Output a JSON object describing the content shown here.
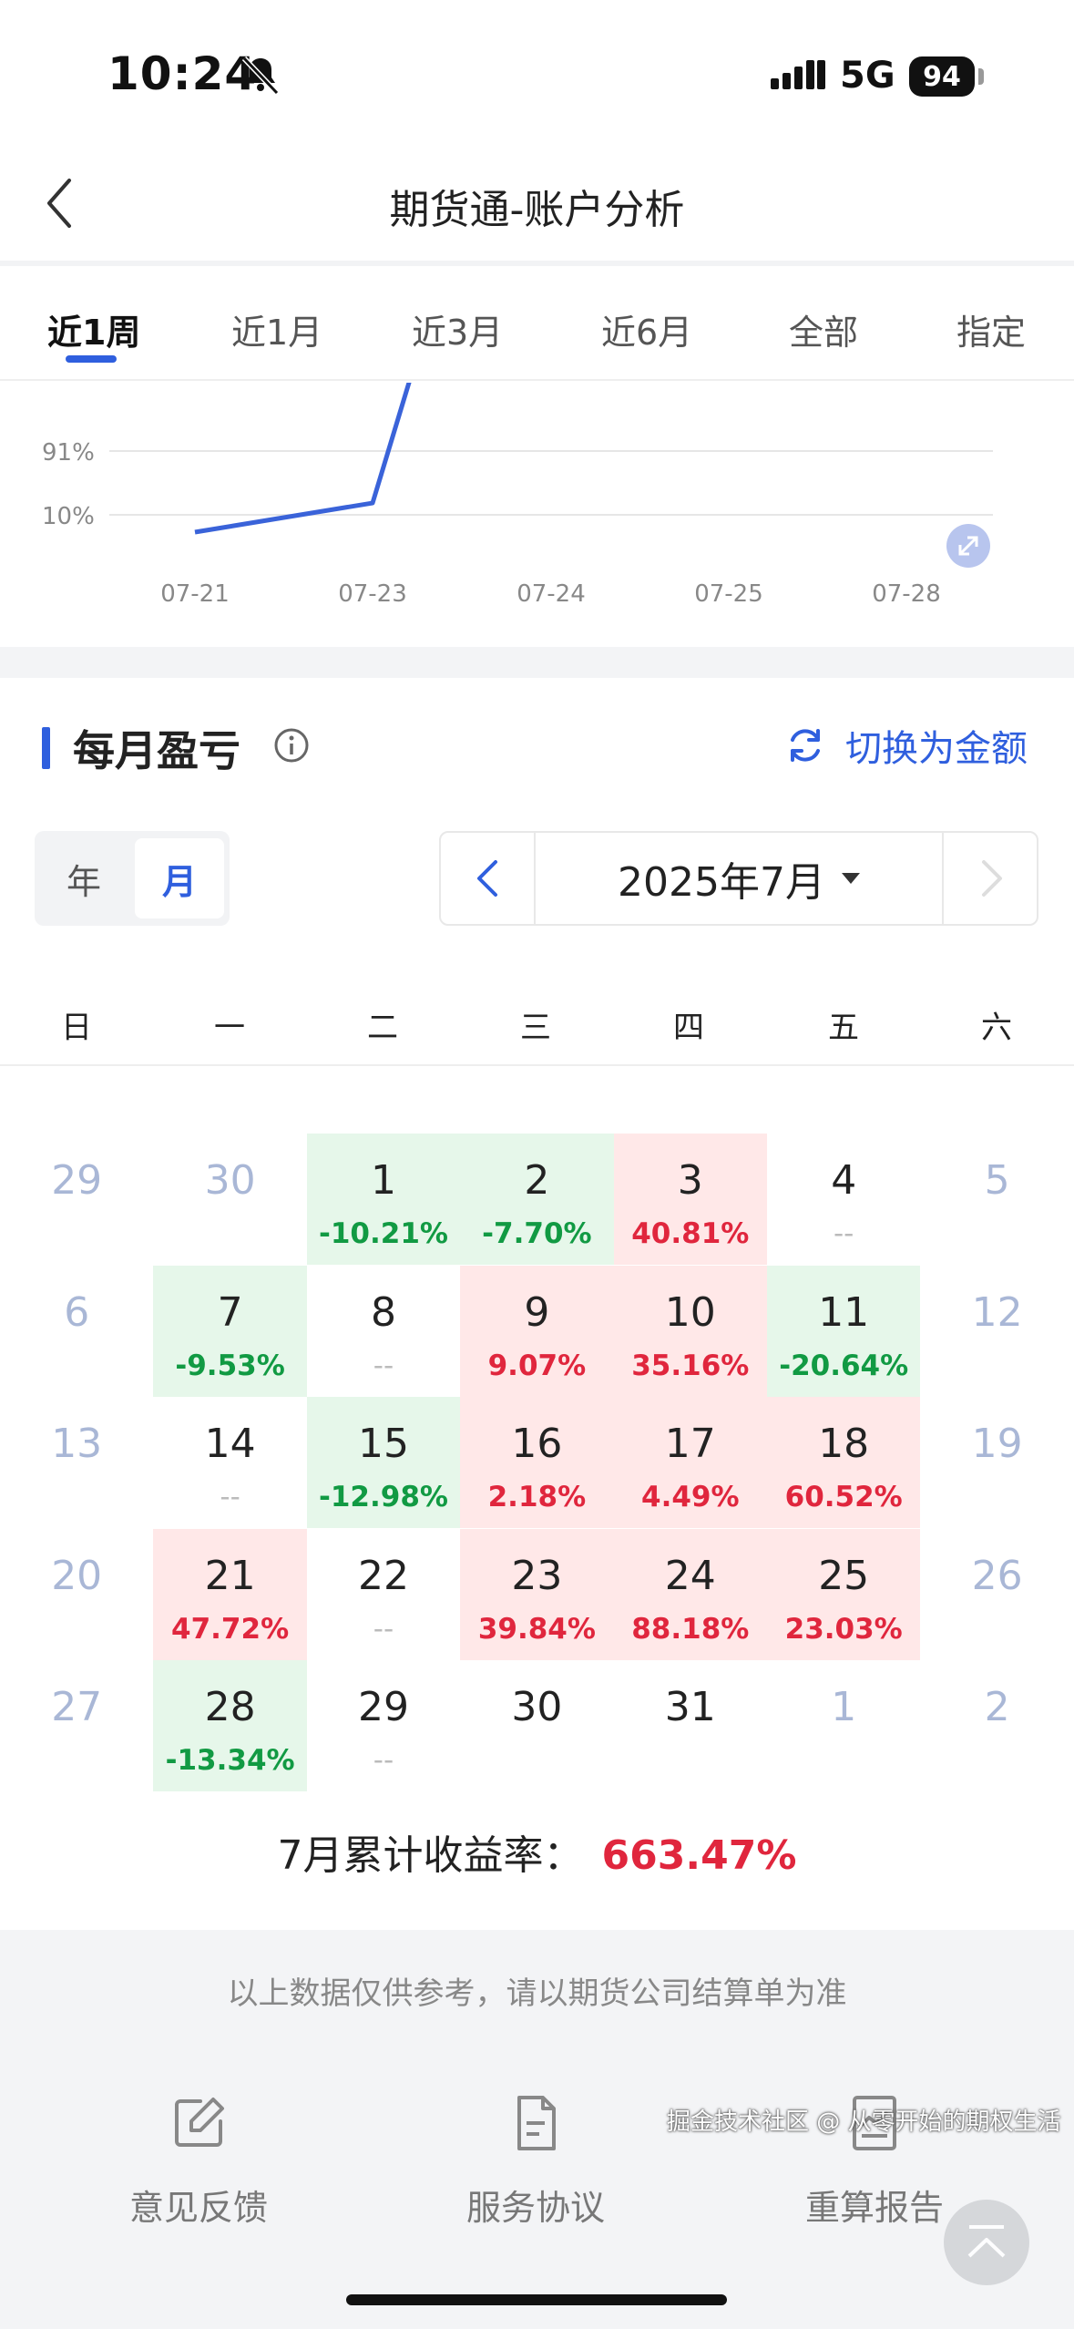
{
  "status_bar": {
    "time": "10:24",
    "network": "5G",
    "battery": "94"
  },
  "nav": {
    "title": "期货通-账户分析"
  },
  "tabs": [
    {
      "label": "近1周",
      "active": true
    },
    {
      "label": "近1月",
      "active": false
    },
    {
      "label": "近3月",
      "active": false
    },
    {
      "label": "近6月",
      "active": false
    },
    {
      "label": "全部",
      "active": false
    },
    {
      "label": "指定",
      "active": false
    }
  ],
  "chart_data": {
    "type": "line",
    "y_tick_labels": [
      "91%",
      "10%"
    ],
    "x": [
      "07-21",
      "07-23",
      "07-24",
      "07-25",
      "07-28"
    ],
    "series": [
      {
        "values": [
          -12,
          25,
          null,
          null,
          null
        ]
      }
    ],
    "note_visible_values": "line rises from below 10% at 07-21 to above 91% just after 07-23; remaining portion scrolled out of view",
    "color": "#3a63d9"
  },
  "section": {
    "title": "每月盈亏",
    "switch_label": "切换为金额"
  },
  "toggle": {
    "year": "年",
    "month": "月"
  },
  "picker": {
    "label": "2025年7月"
  },
  "weekdays": [
    "日",
    "一",
    "二",
    "三",
    "四",
    "五",
    "六"
  ],
  "calendar": [
    {
      "d": "29",
      "other": true
    },
    {
      "d": "30",
      "other": true
    },
    {
      "d": "1",
      "p": "-10.21%",
      "t": "neg"
    },
    {
      "d": "2",
      "p": "-7.70%",
      "t": "neg"
    },
    {
      "d": "3",
      "p": "40.81%",
      "t": "pos"
    },
    {
      "d": "4",
      "p": "--",
      "t": "none"
    },
    {
      "d": "5",
      "other": true
    },
    {
      "d": "6",
      "other": true
    },
    {
      "d": "7",
      "p": "-9.53%",
      "t": "neg"
    },
    {
      "d": "8",
      "p": "--",
      "t": "none"
    },
    {
      "d": "9",
      "p": "9.07%",
      "t": "pos"
    },
    {
      "d": "10",
      "p": "35.16%",
      "t": "pos"
    },
    {
      "d": "11",
      "p": "-20.64%",
      "t": "neg"
    },
    {
      "d": "12",
      "other": true
    },
    {
      "d": "13",
      "other": true
    },
    {
      "d": "14",
      "p": "--",
      "t": "none"
    },
    {
      "d": "15",
      "p": "-12.98%",
      "t": "neg"
    },
    {
      "d": "16",
      "p": "2.18%",
      "t": "pos"
    },
    {
      "d": "17",
      "p": "4.49%",
      "t": "pos"
    },
    {
      "d": "18",
      "p": "60.52%",
      "t": "pos"
    },
    {
      "d": "19",
      "other": true
    },
    {
      "d": "20",
      "other": true
    },
    {
      "d": "21",
      "p": "47.72%",
      "t": "pos"
    },
    {
      "d": "22",
      "p": "--",
      "t": "none"
    },
    {
      "d": "23",
      "p": "39.84%",
      "t": "pos"
    },
    {
      "d": "24",
      "p": "88.18%",
      "t": "pos"
    },
    {
      "d": "25",
      "p": "23.03%",
      "t": "pos"
    },
    {
      "d": "26",
      "other": true
    },
    {
      "d": "27",
      "other": true
    },
    {
      "d": "28",
      "p": "-13.34%",
      "t": "neg"
    },
    {
      "d": "29",
      "p": "--",
      "t": "none"
    },
    {
      "d": "30",
      "t": "plain"
    },
    {
      "d": "31",
      "t": "plain"
    },
    {
      "d": "1",
      "other": true
    },
    {
      "d": "2",
      "other": true
    }
  ],
  "cumulative": {
    "label": "7月累计收益率：",
    "value": "663.47%"
  },
  "footer": {
    "disclaimer": "以上数据仅供参考，请以期货公司结算单为准",
    "items": [
      {
        "label": "意见反馈",
        "icon": "edit-icon"
      },
      {
        "label": "服务协议",
        "icon": "document-icon"
      },
      {
        "label": "重算报告",
        "icon": "report-chart-icon"
      }
    ]
  },
  "watermark": "掘金技术社区 @ 从零开始的期权生活"
}
